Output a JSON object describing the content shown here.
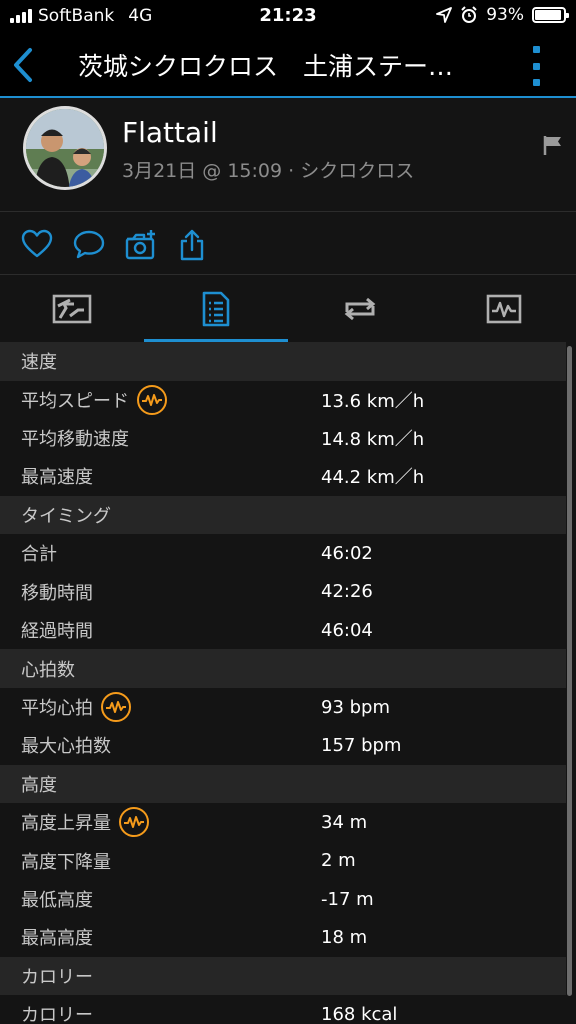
{
  "status_bar": {
    "carrier": "SoftBank",
    "network": "4G",
    "time": "21:23",
    "battery_percent": "93%",
    "battery_level": 0.93
  },
  "nav": {
    "title": "茨城シクロクロス　土浦ステー…"
  },
  "profile": {
    "name": "Flattail",
    "meta": "3月21日 @ 15:09 · シクロクロス"
  },
  "actions": {
    "icons": [
      "heart-icon",
      "comment-icon",
      "add-photo-icon",
      "share-icon"
    ]
  },
  "tabs": {
    "icons": [
      "map-icon",
      "details-icon",
      "laps-icon",
      "chart-icon"
    ],
    "active_index": 1
  },
  "colors": {
    "accent": "#1e8fd1",
    "badge": "#f59b1b",
    "section_bg": "#262626",
    "bg": "#141414"
  },
  "stats": {
    "speed": {
      "header": "速度",
      "rows": [
        {
          "label": "平均スピード",
          "value": "13.6 km／h"
        },
        {
          "label": "平均移動速度",
          "value": "14.8 km／h"
        },
        {
          "label": "最高速度",
          "value": "44.2 km／h"
        }
      ]
    },
    "timing": {
      "header": "タイミング",
      "rows": [
        {
          "label": "合計",
          "value": "46:02"
        },
        {
          "label": "移動時間",
          "value": "42:26"
        },
        {
          "label": "経過時間",
          "value": "46:04"
        }
      ]
    },
    "heart": {
      "header": "心拍数",
      "rows": [
        {
          "label": "平均心拍",
          "value": "93 bpm"
        },
        {
          "label": "最大心拍数",
          "value": "157 bpm"
        }
      ]
    },
    "elevation": {
      "header": "高度",
      "rows": [
        {
          "label": "高度上昇量",
          "value": "34 m"
        },
        {
          "label": "高度下降量",
          "value": "2 m"
        },
        {
          "label": "最低高度",
          "value": "-17 m"
        },
        {
          "label": "最高高度",
          "value": "18 m"
        }
      ]
    },
    "calories": {
      "header": "カロリー",
      "rows": [
        {
          "label": "カロリー",
          "value": "168 kcal"
        }
      ]
    }
  }
}
